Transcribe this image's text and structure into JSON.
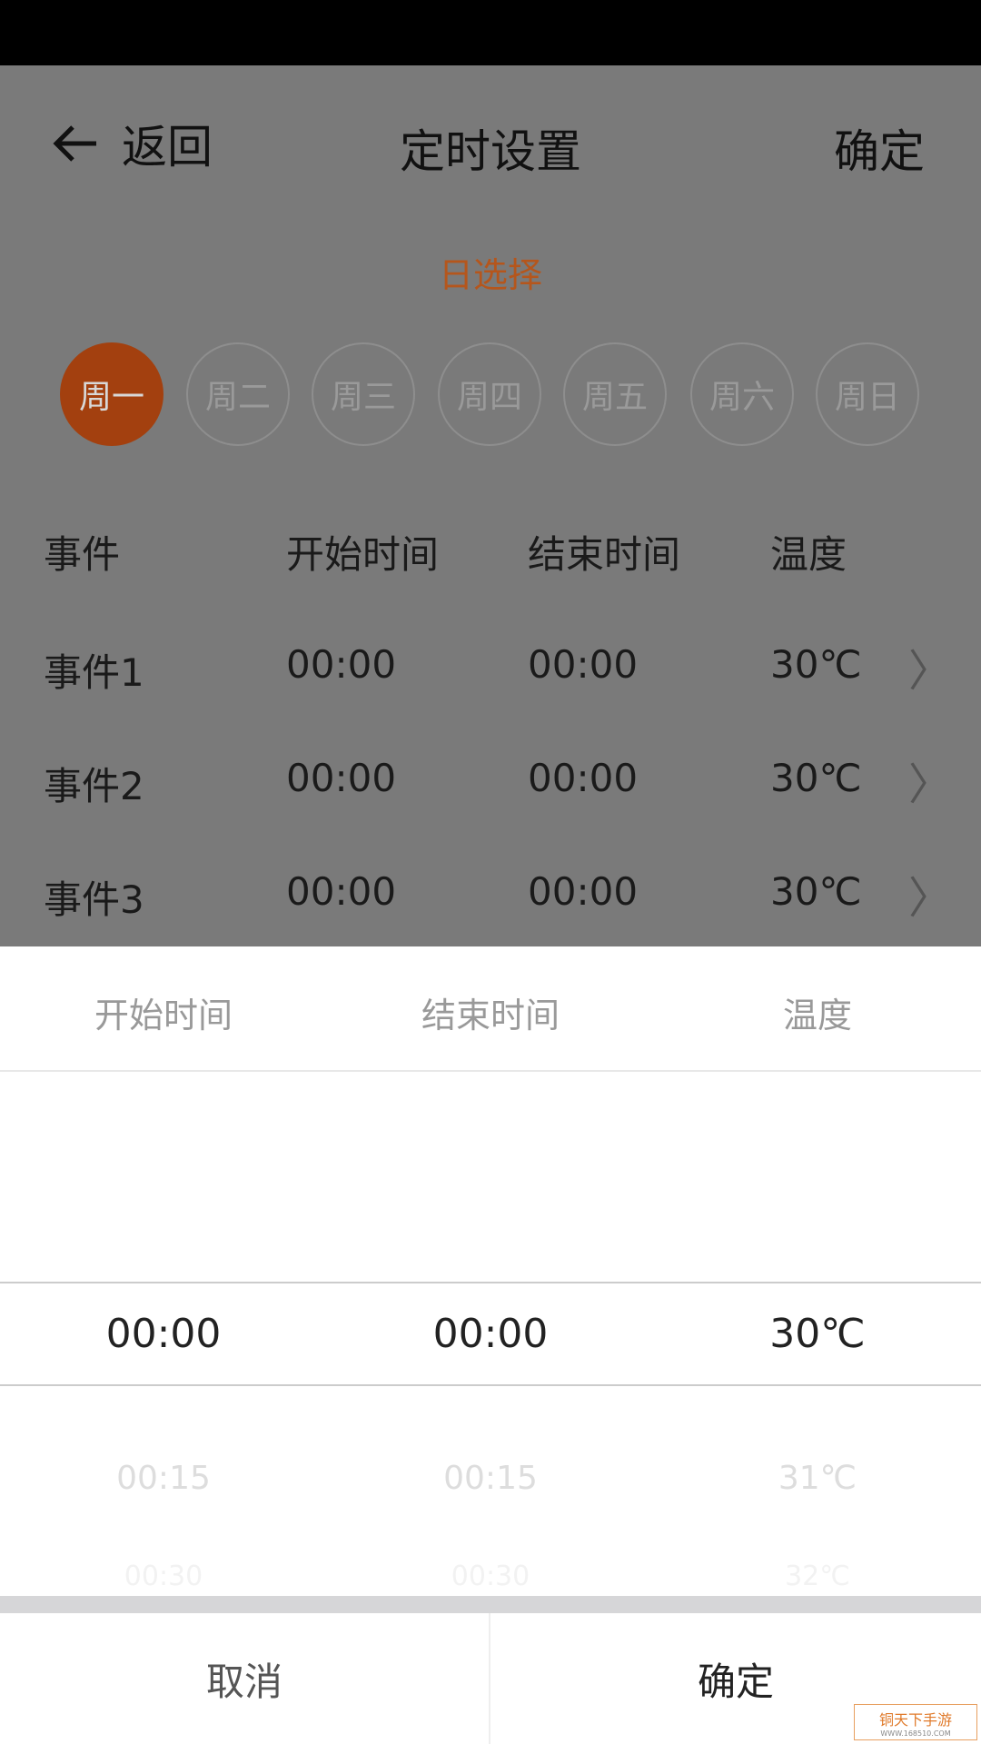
{
  "header": {
    "back_label": "返回",
    "title": "定时设置",
    "confirm_label": "确定"
  },
  "day_select": {
    "label": "日选择",
    "days": [
      "周一",
      "周二",
      "周三",
      "周四",
      "周五",
      "周六",
      "周日"
    ],
    "selected": "周一"
  },
  "table": {
    "headers": [
      "事件",
      "开始时间",
      "结束时间",
      "温度"
    ],
    "rows": [
      [
        "事件1",
        "00:00",
        "00:00",
        "30℃"
      ],
      [
        "事件2",
        "00:00",
        "00:00",
        "30℃"
      ],
      [
        "事件3",
        "00:00",
        "00:00",
        "30℃"
      ]
    ]
  },
  "picker": {
    "headers": [
      "开始时间",
      "结束时间",
      "温度"
    ],
    "selected": [
      "00:00",
      "00:00",
      "30℃"
    ],
    "next": [
      "00:15",
      "00:15",
      "31℃"
    ],
    "next2": [
      "00:30",
      "00:30",
      "32℃"
    ],
    "cancel_label": "取消",
    "confirm_label": "确定"
  },
  "watermark": {
    "text": "铜天下手游",
    "url": "WWW.168510.COM"
  },
  "colors": {
    "accent": "#f0701e"
  }
}
